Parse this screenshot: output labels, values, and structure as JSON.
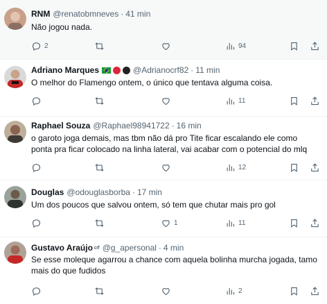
{
  "tweets": [
    {
      "name": "RNM",
      "handle": "@renatobmneves",
      "separator": "·",
      "time": "41 min",
      "text": "Não jogou nada.",
      "replies": "2",
      "retweets": "",
      "likes": "",
      "views": "94",
      "avatar_color": "#c9a08a"
    },
    {
      "name": "Adriano Marques",
      "handle": "@Adrianocrf82",
      "separator": "·",
      "time": "11 min",
      "text": "O melhor do Flamengo ontem, o único que tentava alguma coisa.",
      "replies": "",
      "retweets": "",
      "likes": "",
      "views": "11",
      "avatar_color": "#c62828"
    },
    {
      "name": "Raphael Souza",
      "handle": "@Raphael98941722",
      "separator": "·",
      "time": "16 min",
      "text": "o garoto joga demais, mas tbm não dá pro Tite ficar escalando ele como ponta pra ficar colocado na linha lateral, vai acabar com o potencial do mlq",
      "replies": "",
      "retweets": "",
      "likes": "",
      "views": "12",
      "avatar_color": "#7a5c48"
    },
    {
      "name": "Douglas",
      "handle": "@odouglasborba",
      "separator": "·",
      "time": "17 min",
      "text": "Um dos poucos que salvou ontem, só tem que chutar mais pro gol",
      "replies": "",
      "retweets": "",
      "likes": "1",
      "views": "11",
      "avatar_color": "#5b5f5a"
    },
    {
      "name": "Gustavo Araújo",
      "crf_badge": "crf",
      "handle": "@g_apersonal",
      "separator": "·",
      "time": "4 min",
      "text": "Se esse moleque agarrou a chance com aquela bolinha murcha jogada, tamo mais do que fudidos",
      "replies": "",
      "retweets": "",
      "likes": "",
      "views": "2",
      "avatar_color": "#8e4b3f"
    }
  ],
  "colors": {
    "text_primary": "#0f1419",
    "text_secondary": "#536471",
    "divider": "#eff3f4",
    "highlight_bg": "#f7f9f9"
  },
  "icons": [
    "reply-icon",
    "retweet-icon",
    "like-icon",
    "views-icon",
    "bookmark-icon",
    "share-icon"
  ]
}
